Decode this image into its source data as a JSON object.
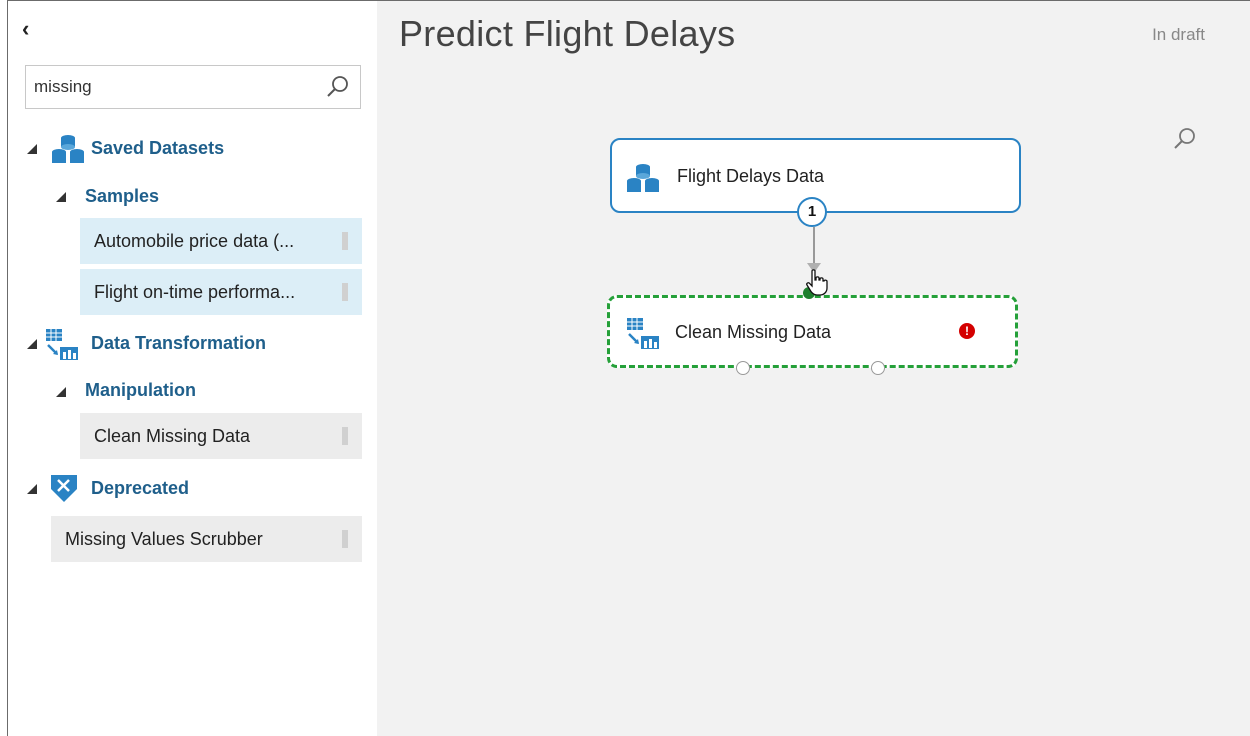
{
  "sidebar": {
    "collapse_glyph": "‹",
    "search": {
      "value": "missing",
      "icon": "search-icon"
    },
    "categories": [
      {
        "label": "Saved Datasets",
        "icon": "datasets-icon",
        "subcategory": "Samples",
        "items": [
          "Automobile price data (...",
          "Flight on-time performa..."
        ]
      },
      {
        "label": "Data Transformation",
        "icon": "data-transformation-icon",
        "subcategory": "Manipulation",
        "items": [
          "Clean Missing Data"
        ]
      },
      {
        "label": "Deprecated",
        "icon": "deprecated-icon",
        "items": [
          "Missing Values Scrubber"
        ]
      }
    ]
  },
  "canvas": {
    "title": "Predict Flight Delays",
    "status": "In draft",
    "modules": [
      {
        "label": "Flight Delays Data",
        "icon": "datasets-icon",
        "output_port_label": "1"
      },
      {
        "label": "Clean Missing Data",
        "icon": "data-transformation-icon",
        "error_glyph": "!"
      }
    ]
  },
  "colors": {
    "accent_blue": "#2a83c4",
    "heading_blue": "#1f5f8b",
    "selected_green": "#25a039",
    "error_red": "#d40000"
  }
}
